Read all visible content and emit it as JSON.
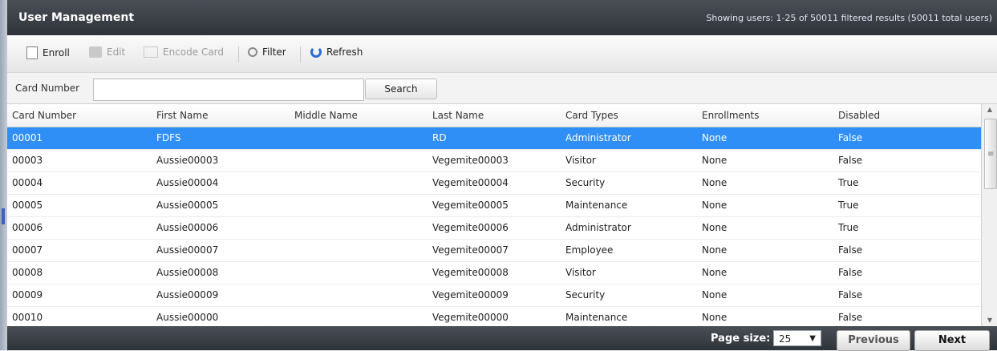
{
  "header": {
    "title": "User Management",
    "info": "Showing users: 1-25 of 50011 filtered results (50011 total users)"
  },
  "toolbar": {
    "enroll": "Enroll",
    "edit": "Edit",
    "encode_card": "Encode Card",
    "filter": "Filter",
    "refresh": "Refresh"
  },
  "search": {
    "label": "Card Number",
    "value": "",
    "button": "Search"
  },
  "table": {
    "columns": [
      "Card Number",
      "First Name",
      "Middle Name",
      "Last Name",
      "Card Types",
      "Enrollments",
      "Disabled"
    ],
    "rows": [
      {
        "card": "00001",
        "first": "FDFS",
        "middle": "",
        "last": "RD",
        "type": "Administrator",
        "enroll": "None",
        "disabled": "False"
      },
      {
        "card": "00003",
        "first": "Aussie00003",
        "middle": "",
        "last": "Vegemite00003",
        "type": "Visitor",
        "enroll": "None",
        "disabled": "False"
      },
      {
        "card": "00004",
        "first": "Aussie00004",
        "middle": "",
        "last": "Vegemite00004",
        "type": "Security",
        "enroll": "None",
        "disabled": "True"
      },
      {
        "card": "00005",
        "first": "Aussie00005",
        "middle": "",
        "last": "Vegemite00005",
        "type": "Maintenance",
        "enroll": "None",
        "disabled": "True"
      },
      {
        "card": "00006",
        "first": "Aussie00006",
        "middle": "",
        "last": "Vegemite00006",
        "type": "Administrator",
        "enroll": "None",
        "disabled": "True"
      },
      {
        "card": "00007",
        "first": "Aussie00007",
        "middle": "",
        "last": "Vegemite00007",
        "type": "Employee",
        "enroll": "None",
        "disabled": "False"
      },
      {
        "card": "00008",
        "first": "Aussie00008",
        "middle": "",
        "last": "Vegemite00008",
        "type": "Visitor",
        "enroll": "None",
        "disabled": "False"
      },
      {
        "card": "00009",
        "first": "Aussie00009",
        "middle": "",
        "last": "Vegemite00009",
        "type": "Security",
        "enroll": "None",
        "disabled": "False"
      },
      {
        "card": "00010",
        "first": "Aussie00000",
        "middle": "",
        "last": "Vegemite00000",
        "type": "Maintenance",
        "enroll": "None",
        "disabled": "False"
      }
    ]
  },
  "footer": {
    "page_size_label": "Page size:",
    "page_size": "25",
    "previous": "Previous",
    "next": "Next"
  },
  "colors": {
    "selected_row": "#2f8ff6",
    "title_bar": "#3a3f46",
    "refresh_icon": "#2a6ccf"
  },
  "icons": {
    "enroll": "page-icon",
    "edit": "edit-icon",
    "encode_card": "encode-card-icon",
    "filter": "magnifier-icon",
    "refresh": "refresh-icon",
    "dropdown": "chevron-down-icon"
  }
}
